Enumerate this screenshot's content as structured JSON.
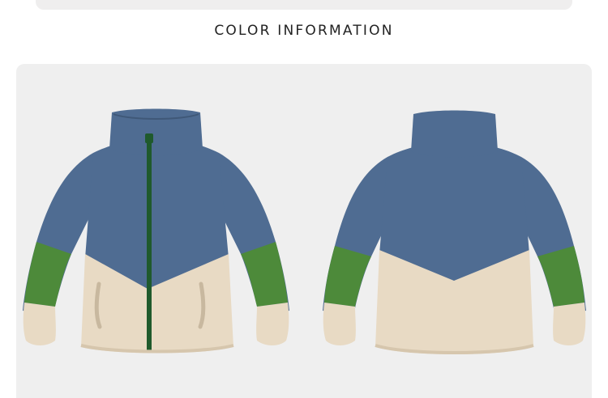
{
  "section": {
    "title": "COLOR INFORMATION"
  },
  "product": {
    "views": [
      {
        "view": "front",
        "icon": "jacket-front-image"
      },
      {
        "view": "back",
        "icon": "jacket-back-image"
      }
    ],
    "colors": {
      "navy_blue": "#4f6c92",
      "green": "#4d8a3a",
      "beige": "#e8dac4",
      "zipper": "#1f5a2c",
      "background": "#efefef"
    }
  }
}
